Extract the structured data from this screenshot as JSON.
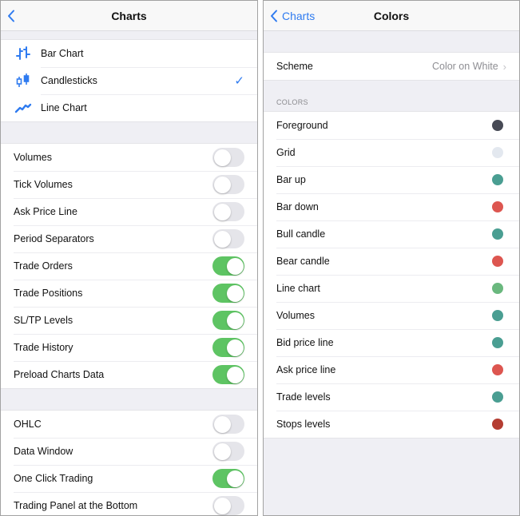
{
  "left": {
    "title": "Charts",
    "back_icon": "chevron-left-icon",
    "chart_types": [
      {
        "label": "Bar Chart",
        "icon": "bar-chart-icon",
        "selected": false
      },
      {
        "label": "Candlesticks",
        "icon": "candlesticks-icon",
        "selected": true
      },
      {
        "label": "Line Chart",
        "icon": "line-chart-icon",
        "selected": false
      }
    ],
    "check_icon": "✓",
    "settings_group1": [
      {
        "label": "Volumes",
        "on": false
      },
      {
        "label": "Tick Volumes",
        "on": false
      },
      {
        "label": "Ask Price Line",
        "on": false
      },
      {
        "label": "Period Separators",
        "on": false
      },
      {
        "label": "Trade Orders",
        "on": true
      },
      {
        "label": "Trade Positions",
        "on": true
      },
      {
        "label": "SL/TP Levels",
        "on": true
      },
      {
        "label": "Trade History",
        "on": true
      },
      {
        "label": "Preload Charts Data",
        "on": true
      }
    ],
    "settings_group2": [
      {
        "label": "OHLC",
        "on": false
      },
      {
        "label": "Data Window",
        "on": false
      },
      {
        "label": "One Click Trading",
        "on": true
      },
      {
        "label": "Trading Panel at the Bottom",
        "on": false
      }
    ]
  },
  "right": {
    "title": "Colors",
    "back_label": "Charts",
    "back_icon": "chevron-left-icon",
    "scheme": {
      "label": "Scheme",
      "value": "Color on White",
      "chevron": "›"
    },
    "section_header": "COLORS",
    "colors": [
      {
        "label": "Foreground",
        "color": "#474a55"
      },
      {
        "label": "Grid",
        "color": "#e3e8ef"
      },
      {
        "label": "Bar up",
        "color": "#4a9e92"
      },
      {
        "label": "Bar down",
        "color": "#dd5650"
      },
      {
        "label": "Bull candle",
        "color": "#4a9e92"
      },
      {
        "label": "Bear candle",
        "color": "#dd5650"
      },
      {
        "label": "Line chart",
        "color": "#6ab87e"
      },
      {
        "label": "Volumes",
        "color": "#4a9e92"
      },
      {
        "label": "Bid price line",
        "color": "#4a9e92"
      },
      {
        "label": "Ask price line",
        "color": "#dd5650"
      },
      {
        "label": "Trade levels",
        "color": "#4a9e92"
      },
      {
        "label": "Stops levels",
        "color": "#b43d32"
      }
    ]
  },
  "accent_color": "#2f7bf0",
  "toggle_on_color": "#5ec463"
}
